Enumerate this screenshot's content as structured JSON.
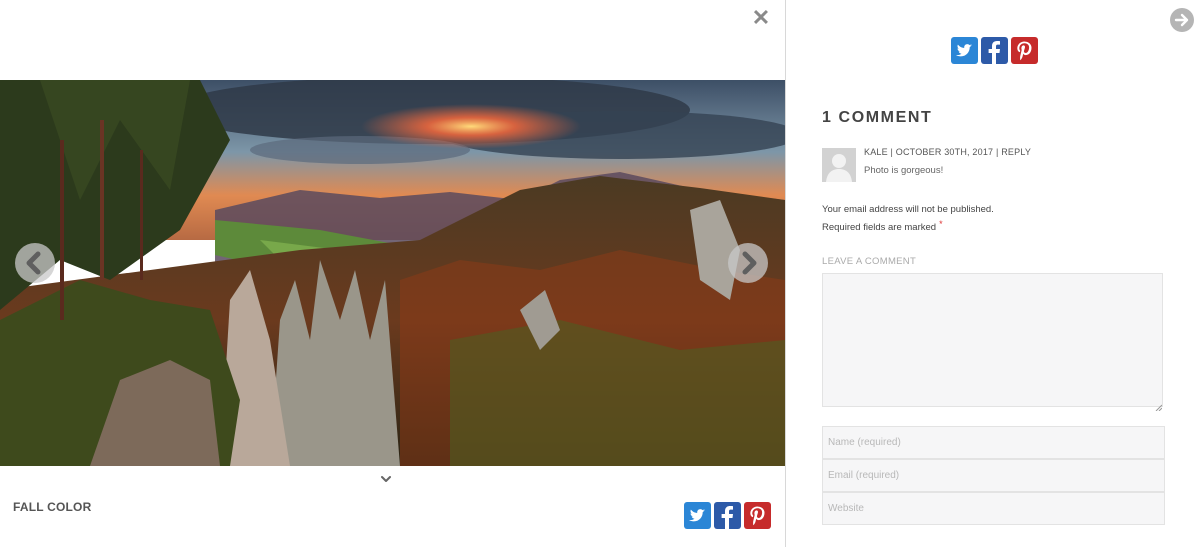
{
  "lightbox": {
    "close_icon": "close-icon",
    "caption": "FALL COLOR",
    "prev_icon": "chevron-left-icon",
    "next_icon": "chevron-right-icon",
    "expand_icon": "chevron-down-icon"
  },
  "share": {
    "items": [
      "twitter-icon",
      "facebook-icon",
      "pinterest-icon"
    ]
  },
  "colors": {
    "twitter": "#2b86d6",
    "facebook": "#2d5aa8",
    "pinterest": "#c62b2b",
    "required_star": "#dd3333"
  },
  "comments": {
    "title": "1 COMMENT",
    "items": [
      {
        "author": "KALE",
        "separator": " | ",
        "date": "OCTOBER 30TH, 2017",
        "reply_label": "REPLY",
        "text": "Photo is gorgeous!"
      }
    ]
  },
  "form": {
    "notice_line1": "Your email address will not be published.",
    "notice_line2": "Required fields are marked",
    "required_marker": "*",
    "leave_label": "LEAVE A COMMENT",
    "name_placeholder": "Name (required)",
    "email_placeholder": "Email (required)",
    "website_placeholder": "Website"
  }
}
